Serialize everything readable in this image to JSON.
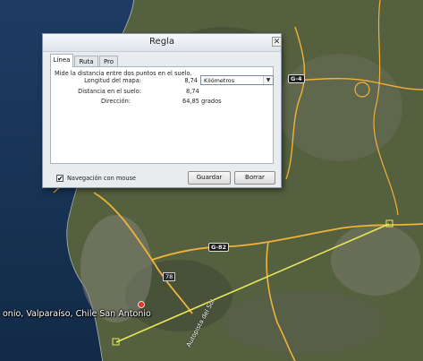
{
  "map": {
    "place_label": "onio, Valparaíso, Chile  San Antonio",
    "route_78": "78",
    "route_g82": "G-82",
    "route_g4": "G-4",
    "road_name": "Autopista del Sol"
  },
  "dialog": {
    "title": "Regla",
    "close_glyph": "✕",
    "tabs": [
      "Línea",
      "Ruta",
      "Pro"
    ],
    "description": "Mide la distancia entre dos puntos en el suelo.",
    "map_length_label": "Longitud del mapa:",
    "map_length_value": "8,74",
    "unit_selected": "Kilómetros",
    "ground_distance_label": "Distancia en el suelo:",
    "ground_distance_value": "8,74",
    "heading_label": "Dirección:",
    "heading_value": "64,85 grados",
    "mouse_nav_label": "Navegación con mouse",
    "mouse_nav_checked": "✔",
    "save_label": "Guardar",
    "clear_label": "Borrar"
  },
  "colors": {
    "ruler_line": "#e8e85a",
    "roads": "#f0b23a",
    "ocean": "#18365a"
  }
}
